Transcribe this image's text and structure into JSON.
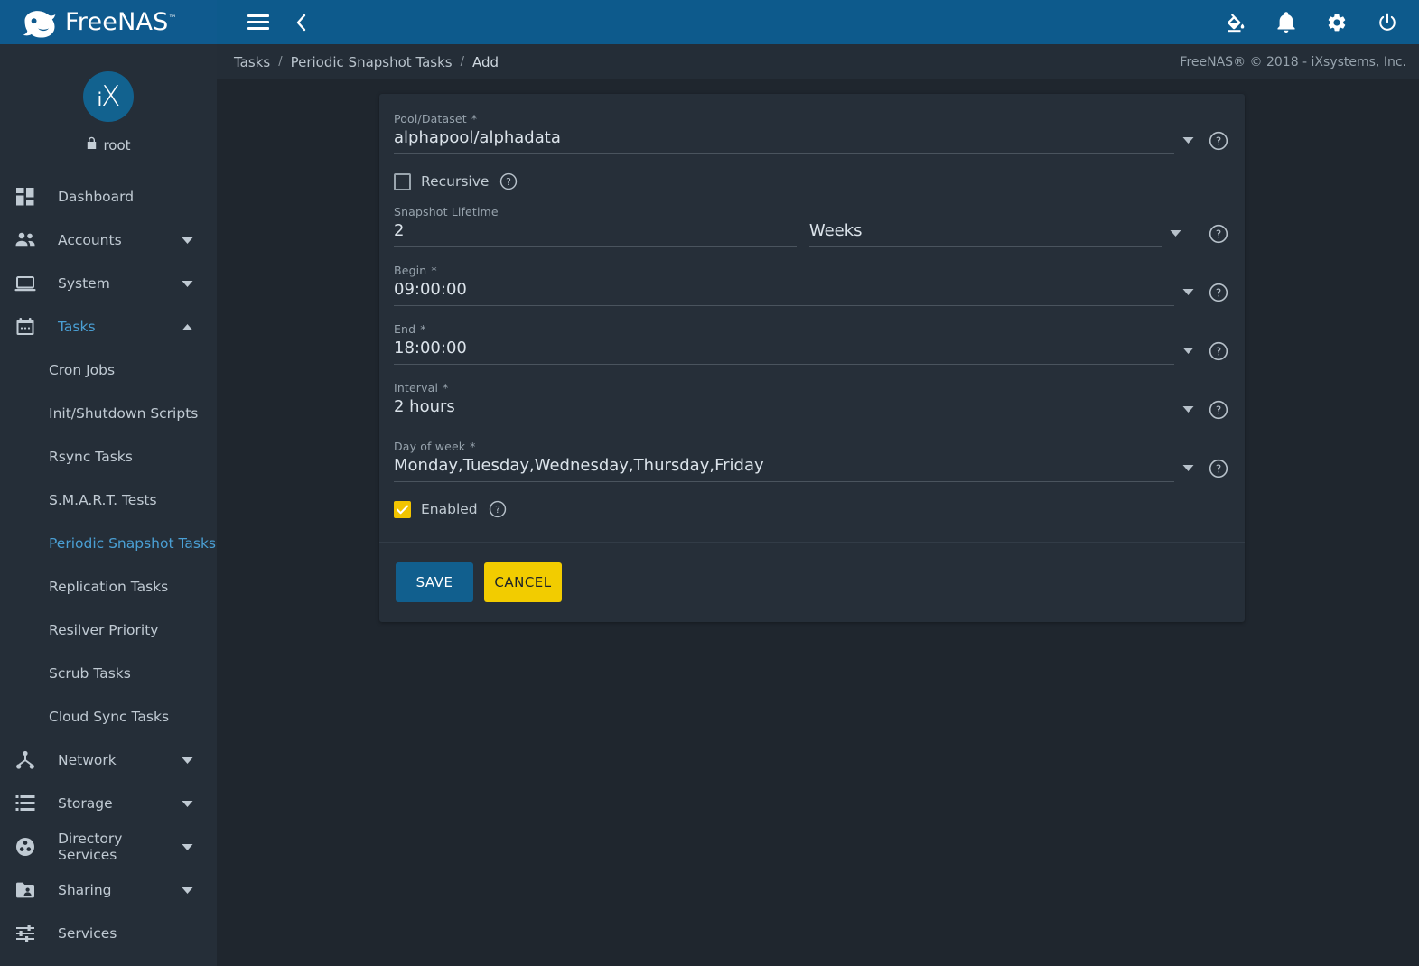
{
  "colors": {
    "brand_blue": "#0f5a8e",
    "accent_blue": "#4a9fd4",
    "accent_yellow": "#f2cc00",
    "page_bg": "#1f262e",
    "sidebar_bg": "#252e38",
    "card_bg": "#262f39"
  },
  "topbar": {
    "brand_name": "FreeNAS",
    "brand_tm": "™",
    "logo_icon": "freenas-fish-logo-icon",
    "menu_icon": "hamburger-menu-icon",
    "back_icon": "chevron-left-icon",
    "icons": [
      {
        "name": "theme-fill-icon",
        "title": "Change Theme"
      },
      {
        "name": "bell-icon",
        "title": "Alerts"
      },
      {
        "name": "gear-icon",
        "title": "Settings"
      },
      {
        "name": "power-icon",
        "title": "Power"
      }
    ]
  },
  "breadcrumb": {
    "items": [
      "Tasks",
      "Periodic Snapshot Tasks",
      "Add"
    ],
    "separator": "/",
    "copyright": "FreeNAS® © 2018 - iXsystems, Inc."
  },
  "sidebar": {
    "logo_text_i": "i",
    "logo_text_x": "X",
    "user": "root",
    "lock_icon": "lock-icon",
    "items": [
      {
        "label": "Dashboard",
        "icon": "dashboard-grid-icon",
        "expandable": false,
        "active": false
      },
      {
        "label": "Accounts",
        "icon": "people-icon",
        "expandable": true,
        "expanded": false,
        "active": false
      },
      {
        "label": "System",
        "icon": "laptop-icon",
        "expandable": true,
        "expanded": false,
        "active": false
      },
      {
        "label": "Tasks",
        "icon": "calendar-icon",
        "expandable": true,
        "expanded": true,
        "active": true
      }
    ],
    "tasks_subitems": [
      {
        "label": "Cron Jobs",
        "active": false
      },
      {
        "label": "Init/Shutdown Scripts",
        "active": false
      },
      {
        "label": "Rsync Tasks",
        "active": false
      },
      {
        "label": "S.M.A.R.T. Tests",
        "active": false
      },
      {
        "label": "Periodic Snapshot Tasks",
        "active": true
      },
      {
        "label": "Replication Tasks",
        "active": false
      },
      {
        "label": "Resilver Priority",
        "active": false
      },
      {
        "label": "Scrub Tasks",
        "active": false
      },
      {
        "label": "Cloud Sync Tasks",
        "active": false
      }
    ],
    "items_after": [
      {
        "label": "Network",
        "icon": "network-node-icon",
        "expandable": true,
        "expanded": false,
        "active": false
      },
      {
        "label": "Storage",
        "icon": "storage-list-icon",
        "expandable": true,
        "expanded": false,
        "active": false
      },
      {
        "label": "Directory Services",
        "icon": "directory-services-icon",
        "expandable": true,
        "expanded": false,
        "active": false
      },
      {
        "label": "Sharing",
        "icon": "folder-share-icon",
        "expandable": true,
        "expanded": false,
        "active": false
      },
      {
        "label": "Services",
        "icon": "sliders-icon",
        "expandable": false,
        "active": false
      }
    ]
  },
  "form": {
    "pool_dataset": {
      "label": "Pool/Dataset",
      "required": "*",
      "value": "alphapool/alphadata",
      "caret_icon": "chevron-down-icon",
      "help_icon": "help-circle-icon"
    },
    "recursive": {
      "label": "Recursive",
      "checked": false,
      "help_icon": "help-circle-icon"
    },
    "snapshot_lifetime": {
      "label": "Snapshot Lifetime",
      "value": "2",
      "unit_value": "Weeks",
      "caret_icon": "chevron-down-icon",
      "help_icon": "help-circle-icon"
    },
    "begin": {
      "label": "Begin",
      "required": "*",
      "value": "09:00:00",
      "caret_icon": "chevron-down-icon",
      "help_icon": "help-circle-icon"
    },
    "end": {
      "label": "End",
      "required": "*",
      "value": "18:00:00",
      "caret_icon": "chevron-down-icon",
      "help_icon": "help-circle-icon"
    },
    "interval": {
      "label": "Interval",
      "required": "*",
      "value": "2 hours",
      "caret_icon": "chevron-down-icon",
      "help_icon": "help-circle-icon"
    },
    "day_of_week": {
      "label": "Day of week",
      "required": "*",
      "value": "Monday,Tuesday,Wednesday,Thursday,Friday",
      "caret_icon": "chevron-down-icon",
      "help_icon": "help-circle-icon"
    },
    "enabled": {
      "label": "Enabled",
      "checked": true,
      "help_icon": "help-circle-icon"
    },
    "actions": {
      "save_label": "SAVE",
      "cancel_label": "CANCEL"
    }
  }
}
